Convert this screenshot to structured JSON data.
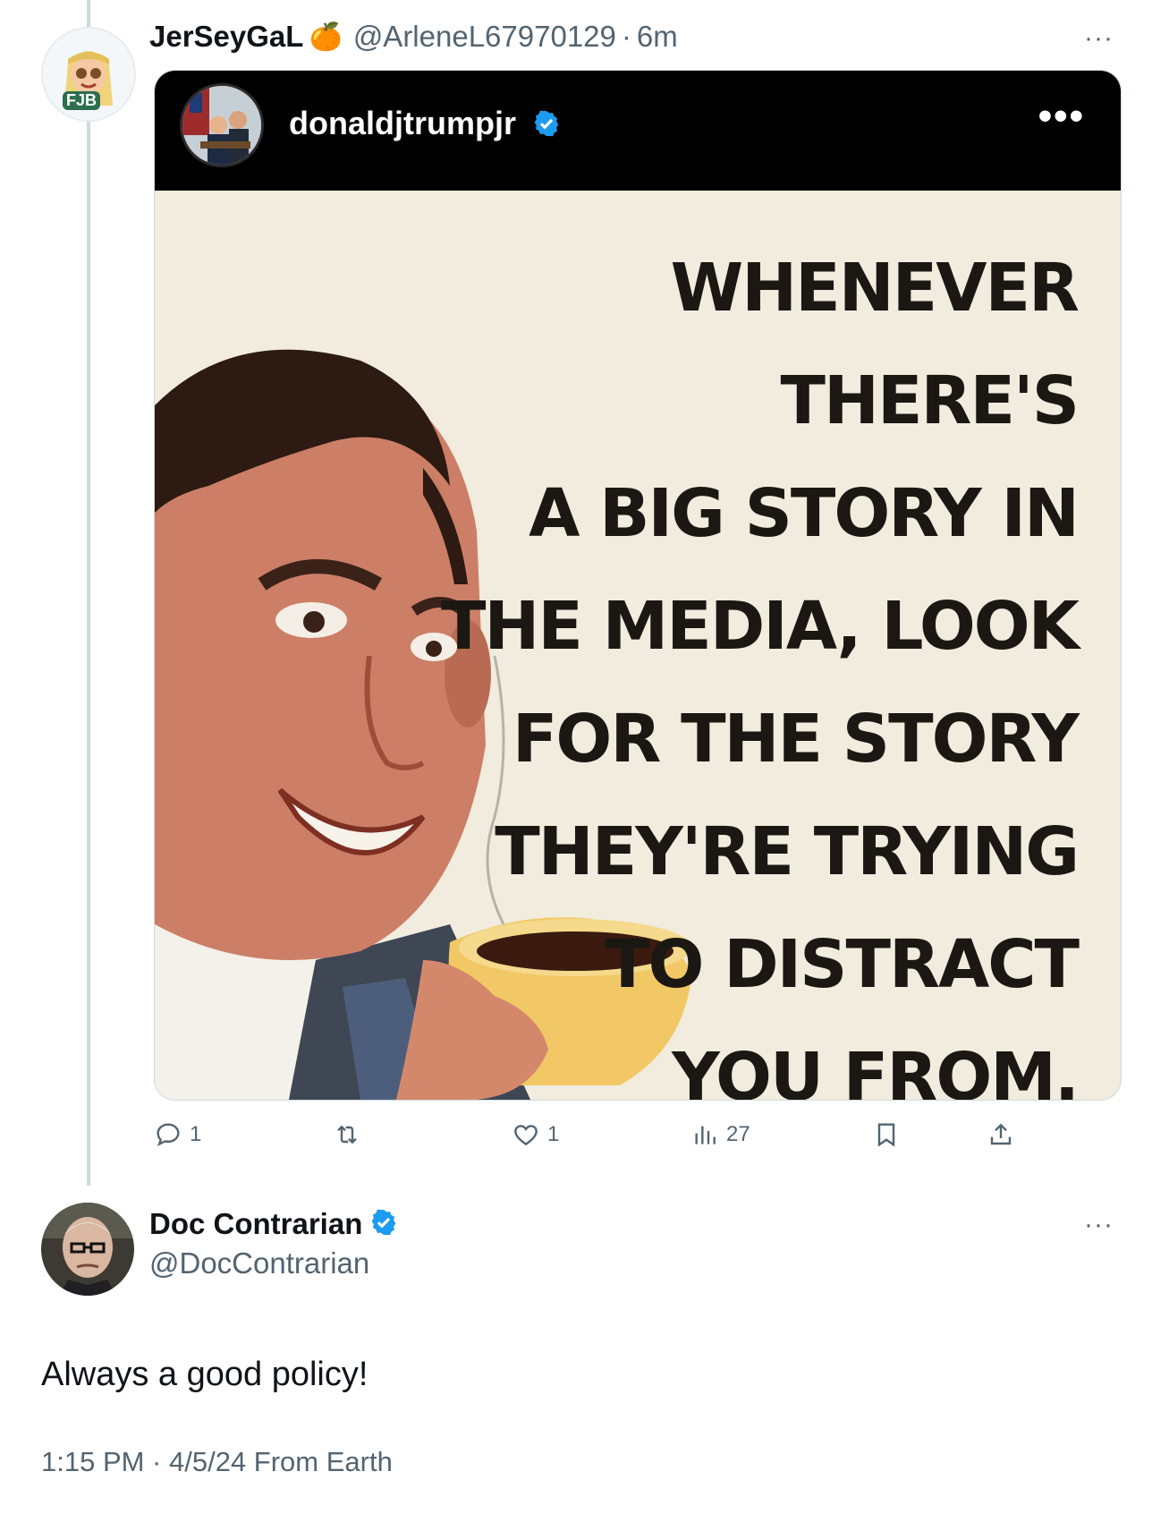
{
  "first_post": {
    "display_name": "JerSeyGaL",
    "name_emoji": "🍊",
    "handle": "@ArleneL67970129",
    "separator": "·",
    "time": "6m",
    "more_label": "···",
    "avatar_badge": "FJB"
  },
  "embedded_media": {
    "account": "donaldjtrumpjr",
    "more_label": "•••",
    "meme_text": "WHENEVER THERE'S\nA BIG STORY IN\nTHE MEDIA, LOOK\nFOR THE STORY\nTHEY'RE TRYING\nTO DISTRACT\nYOU FROM."
  },
  "actions": {
    "replies": "1",
    "reposts": "",
    "likes": "1",
    "views": "27"
  },
  "reply_post": {
    "display_name": "Doc Contrarian",
    "handle": "@DocContrarian",
    "more_label": "···",
    "text": "Always a good policy!",
    "timestamp": "1:15 PM · 4/5/24 From Earth"
  },
  "colors": {
    "verified_blue": "#1d9bf0",
    "muted_gray": "#536471",
    "divider": "#cfd9de"
  }
}
